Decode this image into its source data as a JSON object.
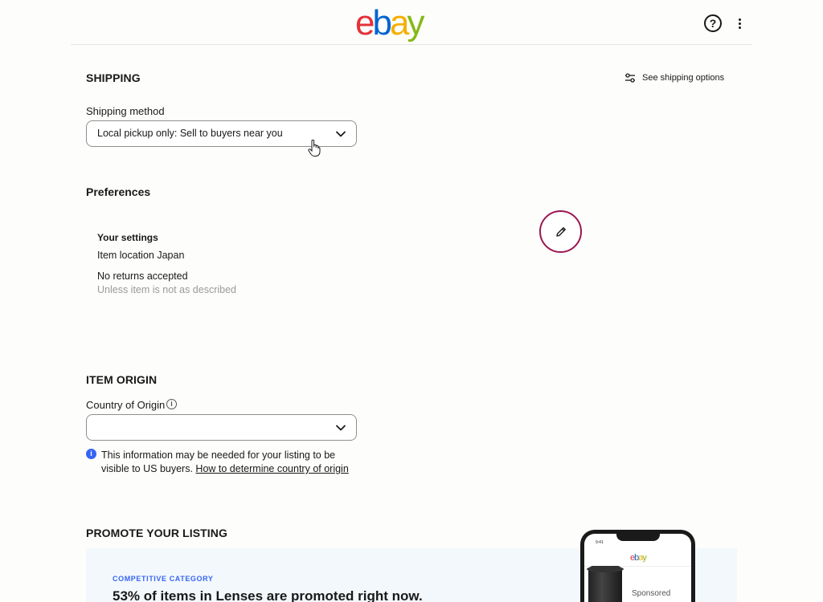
{
  "header": {
    "logo_letters": [
      {
        "ch": "e",
        "color": "#e53238"
      },
      {
        "ch": "b",
        "color": "#0064d2"
      },
      {
        "ch": "a",
        "color": "#f5af02"
      },
      {
        "ch": "y",
        "color": "#86b817"
      }
    ],
    "help_label": "?"
  },
  "shipping": {
    "title": "SHIPPING",
    "see_options": "See shipping options",
    "method_label": "Shipping method",
    "method_value": "Local pickup only: Sell to buyers near you"
  },
  "preferences": {
    "title": "Preferences",
    "settings_title": "Your settings",
    "item_location": "Item location Japan",
    "returns": "No returns accepted",
    "returns_note": "Unless item is not as described"
  },
  "item_origin": {
    "title": "ITEM ORIGIN",
    "country_label": "Country of Origin",
    "country_value": "",
    "info_text": "This information may be needed for your listing to be visible to US buyers. ",
    "info_link": "How to determine country of origin"
  },
  "promote": {
    "title": "PROMOTE YOUR LISTING",
    "category_tag": "COMPETITIVE CATEGORY",
    "headline": "53% of items in Lenses are promoted right now.",
    "phone_time": "9:41",
    "phone_logo": "ebay",
    "sponsored": "Sponsored"
  },
  "colors": {
    "accent_edit": "#9b1650",
    "link_blue": "#3665f3"
  }
}
